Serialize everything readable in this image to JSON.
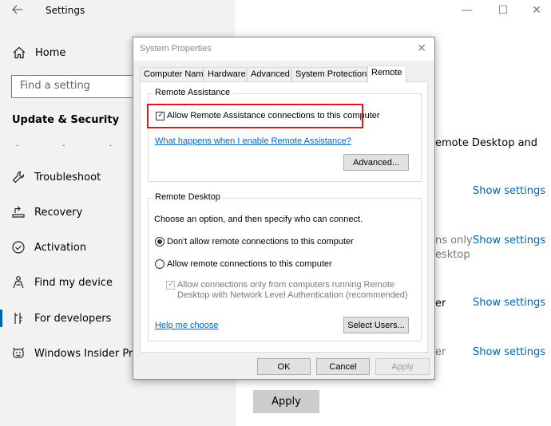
{
  "settings": {
    "window_title": "Settings",
    "home_label": "Home",
    "search_placeholder": "Find a setting",
    "section_title": "Update & Security",
    "nav_items": [
      {
        "label": "Troubleshoot",
        "icon": "wrench-icon"
      },
      {
        "label": "Recovery",
        "icon": "recovery-icon"
      },
      {
        "label": "Activation",
        "icon": "activation-check-icon"
      },
      {
        "label": "Find my device",
        "icon": "find-device-person-icon"
      },
      {
        "label": "For developers",
        "icon": "developer-tools-icon"
      },
      {
        "label": "Windows Insider Prog",
        "icon": "insider-smiley-icon"
      }
    ],
    "window_controls": {
      "minimize": "—",
      "maximize": "☐",
      "close": "✕"
    },
    "main": {
      "fragment_1": "emote Desktop and",
      "fragment_2a": "ns only",
      "fragment_2b": "esktop",
      "fragment_3": "er",
      "fragment_4": "er",
      "show_settings_1": "Show settings",
      "show_settings_2": "Show settings",
      "show_settings_3": "Show settings",
      "show_settings_4": "Show settings",
      "apply_label": "Apply"
    }
  },
  "dialog": {
    "title": "System Properties",
    "close_glyph": "✕",
    "tabs": [
      "Computer Name",
      "Hardware",
      "Advanced",
      "System Protection",
      "Remote"
    ],
    "active_tab": "Remote",
    "remote_assistance": {
      "group_title": "Remote Assistance",
      "allow_label": "Allow Remote Assistance connections to this computer",
      "allow_checked": true,
      "help_link": "What happens when I enable Remote Assistance?",
      "advanced_button": "Advanced..."
    },
    "remote_desktop": {
      "group_title": "Remote Desktop",
      "instruction": "Choose an option, and then specify who can connect.",
      "option_dont_allow": "Don't allow remote connections to this computer",
      "option_allow": "Allow remote connections to this computer",
      "selected_option": "Don't allow remote connections to this computer",
      "nla_line1": "Allow connections only from computers running Remote",
      "nla_line2": "Desktop with Network Level Authentication (recommended)",
      "nla_checked": true,
      "help_link": "Help me choose",
      "select_users_button": "Select Users..."
    },
    "buttons": {
      "ok": "OK",
      "cancel": "Cancel",
      "apply": "Apply"
    }
  }
}
